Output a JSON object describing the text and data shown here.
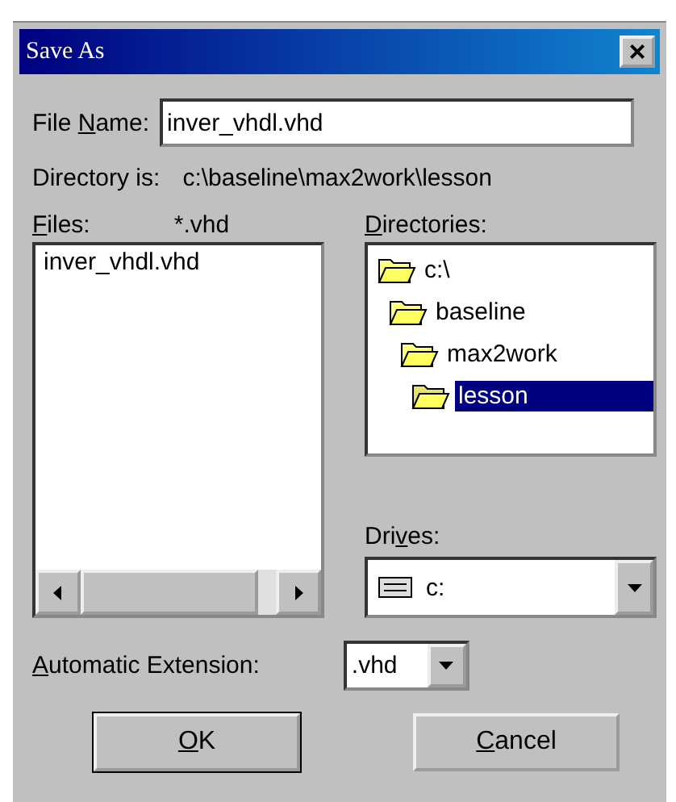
{
  "window": {
    "title": "Save As",
    "close": "×"
  },
  "file_name": {
    "label": {
      "pre": "File ",
      "key": "N",
      "rest": "ame:"
    },
    "value": "inver_vhdl.vhd"
  },
  "directory": {
    "label": "Directory is:",
    "path": "c:\\baseline\\max2work\\lesson"
  },
  "files": {
    "label": {
      "key": "F",
      "rest": "iles:"
    },
    "filter": "*.vhd",
    "items": [
      {
        "name": "inver_vhdl.vhd",
        "selected": false
      }
    ]
  },
  "directories": {
    "label": {
      "key": "D",
      "rest": "irectories:"
    },
    "tree": [
      {
        "name": "c:\\",
        "selected": false,
        "children": [
          {
            "name": "baseline",
            "selected": false,
            "children": [
              {
                "name": "max2work",
                "selected": false,
                "children": [
                  {
                    "name": "lesson",
                    "selected": true
                  }
                ]
              }
            ]
          }
        ]
      }
    ]
  },
  "drives": {
    "label": {
      "pre": "Dri",
      "key": "v",
      "rest": "es:"
    },
    "value": "c:"
  },
  "extension": {
    "label": {
      "key": "A",
      "rest": "utomatic Extension:"
    },
    "value": ".vhd"
  },
  "buttons": [
    {
      "label": {
        "key": "O",
        "rest": "K"
      },
      "kind": "default"
    },
    {
      "label": {
        "key": "C",
        "rest": "ancel"
      },
      "kind": "normal"
    }
  ]
}
